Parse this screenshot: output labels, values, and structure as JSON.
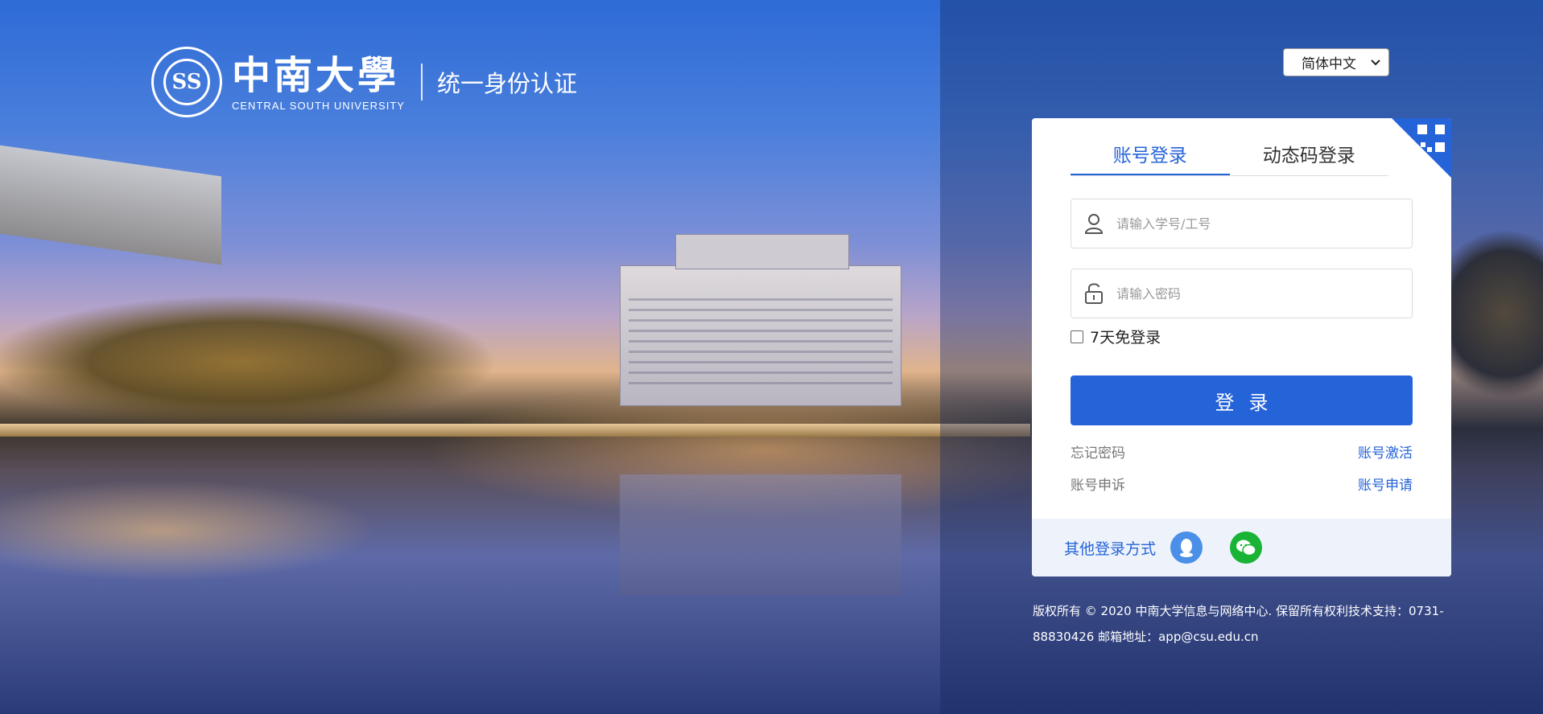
{
  "header": {
    "seal_text": "SS",
    "logo_cn": "中南大學",
    "logo_en": "CENTRAL SOUTH UNIVERSITY",
    "subtitle": "统一身份认证"
  },
  "language": {
    "selected": "简体中文"
  },
  "login": {
    "tabs": [
      {
        "label": "账号登录",
        "active": true
      },
      {
        "label": "动态码登录",
        "active": false
      }
    ],
    "username_placeholder": "请输入学号/工号",
    "password_placeholder": "请输入密码",
    "remember_label": "7天免登录",
    "submit_label": "登录",
    "forgot_password": "忘记密码",
    "activate_account": "账号激活",
    "appeal_account": "账号申诉",
    "apply_account": "账号申请",
    "other_login_label": "其他登录方式"
  },
  "footer": {
    "text": "版权所有 © 2020 中南大学信息与网络中心. 保留所有权利技术支持：0731-88830426 邮箱地址：app@csu.edu.cn"
  },
  "colors": {
    "accent": "#2563d9",
    "qq": "#4a8fe8",
    "wechat": "#19b436"
  }
}
